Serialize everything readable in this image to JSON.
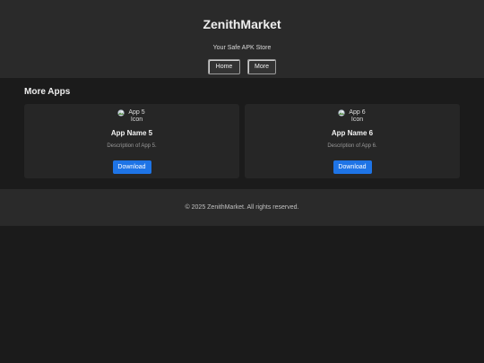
{
  "header": {
    "title": "ZenithMarket",
    "tagline": "Your Safe APK Store",
    "nav": [
      {
        "label": "Home"
      },
      {
        "label": "More"
      }
    ]
  },
  "main": {
    "section_title": "More Apps",
    "apps": [
      {
        "icon_alt_line1": "App 5",
        "icon_alt_line2": "Icon",
        "name": "App Name 5",
        "description": "Description of App 5.",
        "download_label": "Download"
      },
      {
        "icon_alt_line1": "App 6",
        "icon_alt_line2": "Icon",
        "name": "App Name 6",
        "description": "Description of App 6.",
        "download_label": "Download"
      }
    ]
  },
  "footer": {
    "copyright": "© 2025 ZenithMarket. All rights reserved."
  },
  "colors": {
    "background": "#1b1b1b",
    "header_bg": "#2a2a2a",
    "card_bg": "#262626",
    "accent": "#1e74e6"
  },
  "icons": {
    "app_icon": "broken-image-icon"
  }
}
